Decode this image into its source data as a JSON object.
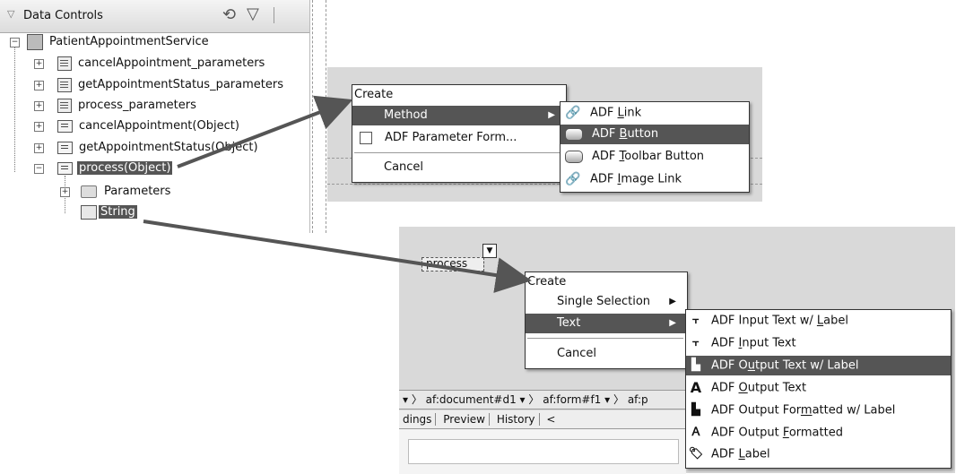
{
  "data_controls": {
    "title": "Data Controls",
    "tree": [
      {
        "label": "PatientAppointmentService"
      },
      {
        "label": "cancelAppointment_parameters"
      },
      {
        "label": "getAppointmentStatus_parameters"
      },
      {
        "label": "process_parameters"
      },
      {
        "label": "cancelAppointment(Object)"
      },
      {
        "label": "getAppointmentStatus(Object)"
      },
      {
        "label": "process(Object)"
      },
      {
        "label": "Parameters"
      },
      {
        "label": "String"
      }
    ]
  },
  "menu1": {
    "header": "Create",
    "items": [
      {
        "label": "Method"
      },
      {
        "label": "ADF Parameter Form..."
      },
      {
        "label": "Cancel"
      }
    ],
    "submenu": [
      {
        "prefix": "ADF ",
        "accel": "L",
        "rest": "ink"
      },
      {
        "prefix": "ADF ",
        "accel": "B",
        "rest": "utton"
      },
      {
        "prefix": "ADF ",
        "accel": "T",
        "rest": "oolbar Button"
      },
      {
        "prefix": "ADF ",
        "accel": "I",
        "rest": "mage Link"
      }
    ]
  },
  "canvas2": {
    "process_label": "process",
    "breadcrumbs": [
      "af:document#d1",
      "af:form#f1",
      "af:p"
    ],
    "tabs": [
      "dings",
      "Preview",
      "History"
    ]
  },
  "menu2": {
    "header": "Create",
    "items": [
      {
        "label": "Single Selection"
      },
      {
        "label": "Text"
      },
      {
        "label": "Cancel"
      }
    ],
    "submenu": [
      {
        "prefix": "ADF Input Text w/ ",
        "accel": "L",
        "rest": "abel"
      },
      {
        "prefix": "ADF ",
        "accel": "I",
        "rest": "nput Text"
      },
      {
        "prefix": "ADF O",
        "accel": "u",
        "rest": "tput Text w/ Label"
      },
      {
        "prefix": "ADF ",
        "accel": "O",
        "rest": "utput Text"
      },
      {
        "prefix": "ADF Output For",
        "accel": "m",
        "rest": "atted w/ Label"
      },
      {
        "prefix": "ADF Output ",
        "accel": "F",
        "rest": "ormatted"
      },
      {
        "prefix": "ADF ",
        "accel": "L",
        "rest": "abel"
      }
    ]
  }
}
